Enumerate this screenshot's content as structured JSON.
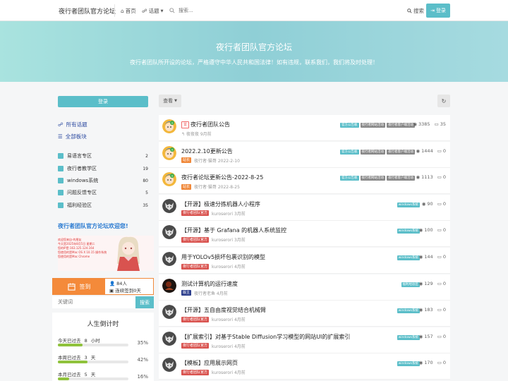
{
  "header": {
    "brand": "夜行者团队官方论坛",
    "nav_home": "首页",
    "nav_topics": "话题",
    "search_placeholder": "搜索...",
    "search_label": "搜索",
    "login_label": "登录"
  },
  "hero": {
    "title": "夜行者团队官方论坛",
    "subtitle": "夜行者团队所开设的论坛，严格遵守中华人民共和国法律！如有违规，联系我们，我们将及时处理！"
  },
  "sidebar": {
    "login_label": "登录",
    "all_topics": "所有话题",
    "all_boards": "全部板块",
    "categories": [
      {
        "name": "易语言专区",
        "count": "2"
      },
      {
        "name": "夜行者教学区",
        "count": "19"
      },
      {
        "name": "windows系统",
        "count": "80"
      },
      {
        "name": "问题反馈专区",
        "count": "5"
      },
      {
        "name": "福利经验区",
        "count": "35"
      }
    ],
    "welcome": "夜行者团队官方论坛欢迎您!",
    "banner_lines": [
      "欢迎您来自-的朋友",
      "今天是2025年8月5日 星期二",
      "您的IP是:163.125.124.164",
      "您使用的是Mac OS X 10.15 操作系统",
      "您使用的是Mac Chrome"
    ],
    "signin": {
      "label": "签到",
      "count": "84人",
      "streak": "连续签到0天"
    },
    "keyword_placeholder": "关键词",
    "keyword_button": "搜索",
    "countdown": {
      "title": "人生倒计时",
      "items": [
        {
          "prefix": "今天已过去",
          "value": "8",
          "unit": "小时",
          "percent_text": "35%",
          "fraction": 0.35
        },
        {
          "prefix": "本周已过去",
          "value": "3",
          "unit": "天",
          "percent_text": "42%",
          "fraction": 0.42
        },
        {
          "prefix": "本月已过去",
          "value": "5",
          "unit": "天",
          "percent_text": "16%",
          "fraction": 0.16
        }
      ]
    }
  },
  "main": {
    "view_label": "查看",
    "threads": [
      {
        "sticky": "置",
        "title": "夜行者团队公告",
        "meta_badge": "",
        "meta": "↰ 夜夜夜 9月前",
        "tags": [
          "官方公告板",
          "夜行者网站活动",
          "夜行者客户端活动"
        ],
        "views": "3385",
        "replies": "35",
        "avatar": "anime"
      },
      {
        "sticky": "",
        "title": "2022.2.10更新公告",
        "meta_badge": "站长",
        "meta": "夜行者·猫哥 2022-2-10",
        "tags": [
          "官方公告板",
          "夜行者网站活动",
          "夜行者客户端活动"
        ],
        "views": "1444",
        "replies": "0",
        "avatar": "anime"
      },
      {
        "sticky": "",
        "title": "夜行者论坛更新公告-2022-8-25",
        "meta_badge": "站长",
        "meta": "夜行者·猫哥 2022-8-25",
        "tags": [
          "官方公告板",
          "夜行者网站活动",
          "夜行者客户端活动"
        ],
        "views": "1113",
        "replies": "0",
        "avatar": "anime"
      },
      {
        "sticky": "",
        "title": "【开源】极速分拣机器人小程序",
        "meta_badge": "夜行者团队官方",
        "meta": "kuroserori 3月前",
        "tags": [
          "windows系统"
        ],
        "views": "90",
        "replies": "0",
        "avatar": "wolf"
      },
      {
        "sticky": "",
        "title": "【开源】基于 Grafana 的机器人系统监控",
        "meta_badge": "夜行者团队官方",
        "meta": "kuroserori 3月前",
        "tags": [
          "windows系统"
        ],
        "views": "100",
        "replies": "0",
        "avatar": "wolf"
      },
      {
        "sticky": "",
        "title": "用于YOLOv5损坏包裹识别的模型",
        "meta_badge": "夜行者团队官方",
        "meta": "kuroserori 4月前",
        "tags": [
          "windows系统"
        ],
        "views": "144",
        "replies": "0",
        "avatar": "wolf"
      },
      {
        "sticky": "",
        "title": "测试计算机的运行速度",
        "meta_badge": "版主",
        "meta": "夜行者老鱼 4月前",
        "tags": [
          "福利经验区"
        ],
        "views": "129",
        "replies": "0",
        "avatar": "dark"
      },
      {
        "sticky": "",
        "title": "【开源】五自由度视觉结合机械臂",
        "meta_badge": "夜行者团队官方",
        "meta": "kuroserori 4月前",
        "tags": [
          "windows系统"
        ],
        "views": "183",
        "replies": "0",
        "avatar": "wolf"
      },
      {
        "sticky": "",
        "title": "【扩展索引】对基于Stable Diffusion学习模型的网站UI的扩展索引",
        "meta_badge": "夜行者团队官方",
        "meta": "kuroserori 4月前",
        "tags": [
          "windows系统"
        ],
        "views": "157",
        "replies": "0",
        "avatar": "wolf"
      },
      {
        "sticky": "",
        "title": "【模板】应用展示网页",
        "meta_badge": "夜行者团队官方",
        "meta": "kuroserori 4月前",
        "tags": [
          "windows系统"
        ],
        "views": "170",
        "replies": "0",
        "avatar": "wolf"
      }
    ]
  },
  "colors": {
    "accent": "#5bbec9",
    "signin": "#f48a3a",
    "progress": "#8fc23c"
  }
}
